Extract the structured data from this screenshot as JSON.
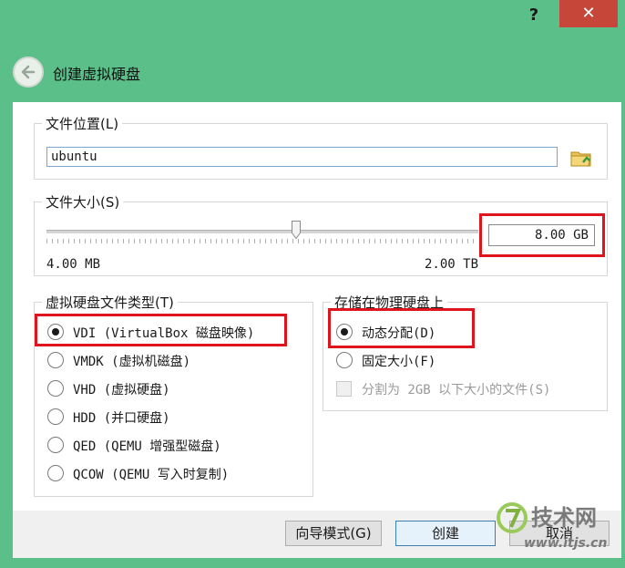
{
  "window": {
    "help_label": "?",
    "close_label": "✕"
  },
  "wizard": {
    "title": "创建虚拟硬盘",
    "back_icon": "back-arrow-icon"
  },
  "file_location": {
    "group_label": "文件位置(L)",
    "value": "ubuntu",
    "browse_icon": "folder-icon"
  },
  "file_size": {
    "group_label": "文件大小(S)",
    "value": "8.00 GB",
    "min_label": "4.00 MB",
    "max_label": "2.00 TB"
  },
  "disk_type": {
    "group_label": "虚拟硬盘文件类型(T)",
    "options": [
      {
        "label": "VDI (VirtualBox 磁盘映像)",
        "checked": true
      },
      {
        "label": "VMDK (虚拟机磁盘)",
        "checked": false
      },
      {
        "label": "VHD (虚拟硬盘)",
        "checked": false
      },
      {
        "label": "HDD (并口硬盘)",
        "checked": false
      },
      {
        "label": "QED (QEMU 增强型磁盘)",
        "checked": false
      },
      {
        "label": "QCOW (QEMU 写入时复制)",
        "checked": false
      }
    ]
  },
  "storage": {
    "group_label": "存储在物理硬盘上",
    "options": [
      {
        "label": "动态分配(D)",
        "checked": true
      },
      {
        "label": "固定大小(F)",
        "checked": false
      }
    ],
    "split_label": "分割为 2GB 以下大小的文件(S)"
  },
  "buttons": {
    "guided_mode": "向导模式(G)",
    "create": "创建",
    "cancel": "取消"
  },
  "watermark": {
    "brand": "技术网",
    "url": "www.itjs.cn"
  },
  "colors": {
    "window_bg": "#5abf88",
    "close_bg": "#c7463a",
    "highlight": "#e0141c"
  }
}
